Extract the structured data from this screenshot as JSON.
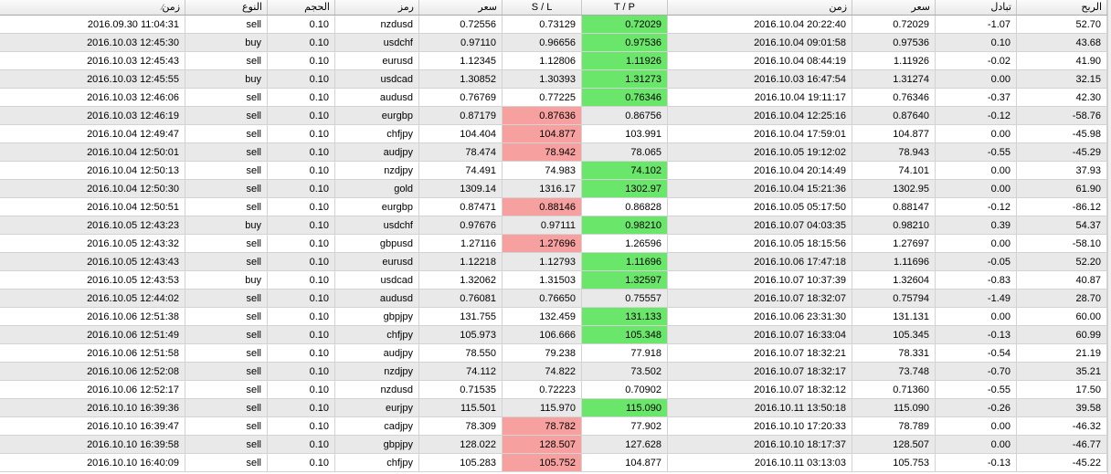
{
  "columns": [
    {
      "key": "open_time",
      "label": "زمن"
    },
    {
      "key": "type",
      "label": "النوع"
    },
    {
      "key": "volume",
      "label": "الحجم"
    },
    {
      "key": "symbol",
      "label": "رمز"
    },
    {
      "key": "open_price",
      "label": "سعر"
    },
    {
      "key": "sl",
      "label": "S / L"
    },
    {
      "key": "tp",
      "label": "T / P"
    },
    {
      "key": "close_time",
      "label": "زمن"
    },
    {
      "key": "close_price",
      "label": "سعر"
    },
    {
      "key": "swap",
      "label": "تبادل"
    },
    {
      "key": "profit",
      "label": "الربح"
    }
  ],
  "sort_indicator": "⁄",
  "colors": {
    "hit_green": "#6ae66a",
    "hit_red": "#f7a0a0",
    "alt_row": "#e9e9e9"
  },
  "rows": [
    {
      "open_time": "2016.09.30 11:04:31",
      "type": "sell",
      "volume": "0.10",
      "symbol": "nzdusd",
      "open_price": "0.72556",
      "sl": "0.73129",
      "tp": "0.72029",
      "close_time": "2016.10.04 20:22:40",
      "close_price": "0.72029",
      "swap": "-1.07",
      "profit": "52.70",
      "hit": "tp"
    },
    {
      "open_time": "2016.10.03 12:45:30",
      "type": "buy",
      "volume": "0.10",
      "symbol": "usdchf",
      "open_price": "0.97110",
      "sl": "0.96656",
      "tp": "0.97536",
      "close_time": "2016.10.04 09:01:58",
      "close_price": "0.97536",
      "swap": "0.10",
      "profit": "43.68",
      "hit": "tp"
    },
    {
      "open_time": "2016.10.03 12:45:43",
      "type": "sell",
      "volume": "0.10",
      "symbol": "eurusd",
      "open_price": "1.12345",
      "sl": "1.12806",
      "tp": "1.11926",
      "close_time": "2016.10.04 08:44:19",
      "close_price": "1.11926",
      "swap": "-0.02",
      "profit": "41.90",
      "hit": "tp"
    },
    {
      "open_time": "2016.10.03 12:45:55",
      "type": "buy",
      "volume": "0.10",
      "symbol": "usdcad",
      "open_price": "1.30852",
      "sl": "1.30393",
      "tp": "1.31273",
      "close_time": "2016.10.03 16:47:54",
      "close_price": "1.31274",
      "swap": "0.00",
      "profit": "32.15",
      "hit": "tp"
    },
    {
      "open_time": "2016.10.03 12:46:06",
      "type": "sell",
      "volume": "0.10",
      "symbol": "audusd",
      "open_price": "0.76769",
      "sl": "0.77225",
      "tp": "0.76346",
      "close_time": "2016.10.04 19:11:17",
      "close_price": "0.76346",
      "swap": "-0.37",
      "profit": "42.30",
      "hit": "tp"
    },
    {
      "open_time": "2016.10.03 12:46:19",
      "type": "sell",
      "volume": "0.10",
      "symbol": "eurgbp",
      "open_price": "0.87179",
      "sl": "0.87636",
      "tp": "0.86756",
      "close_time": "2016.10.04 12:25:16",
      "close_price": "0.87640",
      "swap": "-0.12",
      "profit": "-58.76",
      "hit": "sl"
    },
    {
      "open_time": "2016.10.04 12:49:47",
      "type": "sell",
      "volume": "0.10",
      "symbol": "chfjpy",
      "open_price": "104.404",
      "sl": "104.877",
      "tp": "103.991",
      "close_time": "2016.10.04 17:59:01",
      "close_price": "104.877",
      "swap": "0.00",
      "profit": "-45.98",
      "hit": "sl"
    },
    {
      "open_time": "2016.10.04 12:50:01",
      "type": "sell",
      "volume": "0.10",
      "symbol": "audjpy",
      "open_price": "78.474",
      "sl": "78.942",
      "tp": "78.065",
      "close_time": "2016.10.05 19:12:02",
      "close_price": "78.943",
      "swap": "-0.55",
      "profit": "-45.29",
      "hit": "sl"
    },
    {
      "open_time": "2016.10.04 12:50:13",
      "type": "sell",
      "volume": "0.10",
      "symbol": "nzdjpy",
      "open_price": "74.491",
      "sl": "74.983",
      "tp": "74.102",
      "close_time": "2016.10.04 20:14:49",
      "close_price": "74.101",
      "swap": "0.00",
      "profit": "37.93",
      "hit": "tp"
    },
    {
      "open_time": "2016.10.04 12:50:30",
      "type": "sell",
      "volume": "0.10",
      "symbol": "gold",
      "open_price": "1309.14",
      "sl": "1316.17",
      "tp": "1302.97",
      "close_time": "2016.10.04 15:21:36",
      "close_price": "1302.95",
      "swap": "0.00",
      "profit": "61.90",
      "hit": "tp"
    },
    {
      "open_time": "2016.10.04 12:50:51",
      "type": "sell",
      "volume": "0.10",
      "symbol": "eurgbp",
      "open_price": "0.87471",
      "sl": "0.88146",
      "tp": "0.86828",
      "close_time": "2016.10.05 05:17:50",
      "close_price": "0.88147",
      "swap": "-0.12",
      "profit": "-86.12",
      "hit": "sl"
    },
    {
      "open_time": "2016.10.05 12:43:23",
      "type": "buy",
      "volume": "0.10",
      "symbol": "usdchf",
      "open_price": "0.97676",
      "sl": "0.97111",
      "tp": "0.98210",
      "close_time": "2016.10.07 04:03:35",
      "close_price": "0.98210",
      "swap": "0.39",
      "profit": "54.37",
      "hit": "tp"
    },
    {
      "open_time": "2016.10.05 12:43:32",
      "type": "sell",
      "volume": "0.10",
      "symbol": "gbpusd",
      "open_price": "1.27116",
      "sl": "1.27696",
      "tp": "1.26596",
      "close_time": "2016.10.05 18:15:56",
      "close_price": "1.27697",
      "swap": "0.00",
      "profit": "-58.10",
      "hit": "sl"
    },
    {
      "open_time": "2016.10.05 12:43:43",
      "type": "sell",
      "volume": "0.10",
      "symbol": "eurusd",
      "open_price": "1.12218",
      "sl": "1.12793",
      "tp": "1.11696",
      "close_time": "2016.10.06 17:47:18",
      "close_price": "1.11696",
      "swap": "-0.05",
      "profit": "52.20",
      "hit": "tp"
    },
    {
      "open_time": "2016.10.05 12:43:53",
      "type": "buy",
      "volume": "0.10",
      "symbol": "usdcad",
      "open_price": "1.32062",
      "sl": "1.31503",
      "tp": "1.32597",
      "close_time": "2016.10.07 10:37:39",
      "close_price": "1.32604",
      "swap": "-0.83",
      "profit": "40.87",
      "hit": "tp"
    },
    {
      "open_time": "2016.10.05 12:44:02",
      "type": "sell",
      "volume": "0.10",
      "symbol": "audusd",
      "open_price": "0.76081",
      "sl": "0.76650",
      "tp": "0.75557",
      "close_time": "2016.10.07 18:32:07",
      "close_price": "0.75794",
      "swap": "-1.49",
      "profit": "28.70",
      "hit": ""
    },
    {
      "open_time": "2016.10.06 12:51:38",
      "type": "sell",
      "volume": "0.10",
      "symbol": "gbpjpy",
      "open_price": "131.755",
      "sl": "132.459",
      "tp": "131.133",
      "close_time": "2016.10.06 23:31:30",
      "close_price": "131.131",
      "swap": "0.00",
      "profit": "60.00",
      "hit": "tp"
    },
    {
      "open_time": "2016.10.06 12:51:49",
      "type": "sell",
      "volume": "0.10",
      "symbol": "chfjpy",
      "open_price": "105.973",
      "sl": "106.666",
      "tp": "105.348",
      "close_time": "2016.10.07 16:33:04",
      "close_price": "105.345",
      "swap": "-0.13",
      "profit": "60.99",
      "hit": "tp"
    },
    {
      "open_time": "2016.10.06 12:51:58",
      "type": "sell",
      "volume": "0.10",
      "symbol": "audjpy",
      "open_price": "78.550",
      "sl": "79.238",
      "tp": "77.918",
      "close_time": "2016.10.07 18:32:21",
      "close_price": "78.331",
      "swap": "-0.54",
      "profit": "21.19",
      "hit": ""
    },
    {
      "open_time": "2016.10.06 12:52:08",
      "type": "sell",
      "volume": "0.10",
      "symbol": "nzdjpy",
      "open_price": "74.112",
      "sl": "74.822",
      "tp": "73.502",
      "close_time": "2016.10.07 18:32:17",
      "close_price": "73.748",
      "swap": "-0.70",
      "profit": "35.21",
      "hit": ""
    },
    {
      "open_time": "2016.10.06 12:52:17",
      "type": "sell",
      "volume": "0.10",
      "symbol": "nzdusd",
      "open_price": "0.71535",
      "sl": "0.72223",
      "tp": "0.70902",
      "close_time": "2016.10.07 18:32:12",
      "close_price": "0.71360",
      "swap": "-0.55",
      "profit": "17.50",
      "hit": ""
    },
    {
      "open_time": "2016.10.10 16:39:36",
      "type": "sell",
      "volume": "0.10",
      "symbol": "eurjpy",
      "open_price": "115.501",
      "sl": "115.970",
      "tp": "115.090",
      "close_time": "2016.10.11 13:50:18",
      "close_price": "115.090",
      "swap": "-0.26",
      "profit": "39.58",
      "hit": "tp"
    },
    {
      "open_time": "2016.10.10 16:39:47",
      "type": "sell",
      "volume": "0.10",
      "symbol": "cadjpy",
      "open_price": "78.309",
      "sl": "78.782",
      "tp": "77.902",
      "close_time": "2016.10.10 17:20:33",
      "close_price": "78.789",
      "swap": "0.00",
      "profit": "-46.32",
      "hit": "sl"
    },
    {
      "open_time": "2016.10.10 16:39:58",
      "type": "sell",
      "volume": "0.10",
      "symbol": "gbpjpy",
      "open_price": "128.022",
      "sl": "128.507",
      "tp": "127.628",
      "close_time": "2016.10.10 18:17:37",
      "close_price": "128.507",
      "swap": "0.00",
      "profit": "-46.77",
      "hit": "sl"
    },
    {
      "open_time": "2016.10.10 16:40:09",
      "type": "sell",
      "volume": "0.10",
      "symbol": "chfjpy",
      "open_price": "105.283",
      "sl": "105.752",
      "tp": "104.877",
      "close_time": "2016.10.11 03:13:03",
      "close_price": "105.753",
      "swap": "-0.13",
      "profit": "-45.22",
      "hit": "sl"
    }
  ]
}
